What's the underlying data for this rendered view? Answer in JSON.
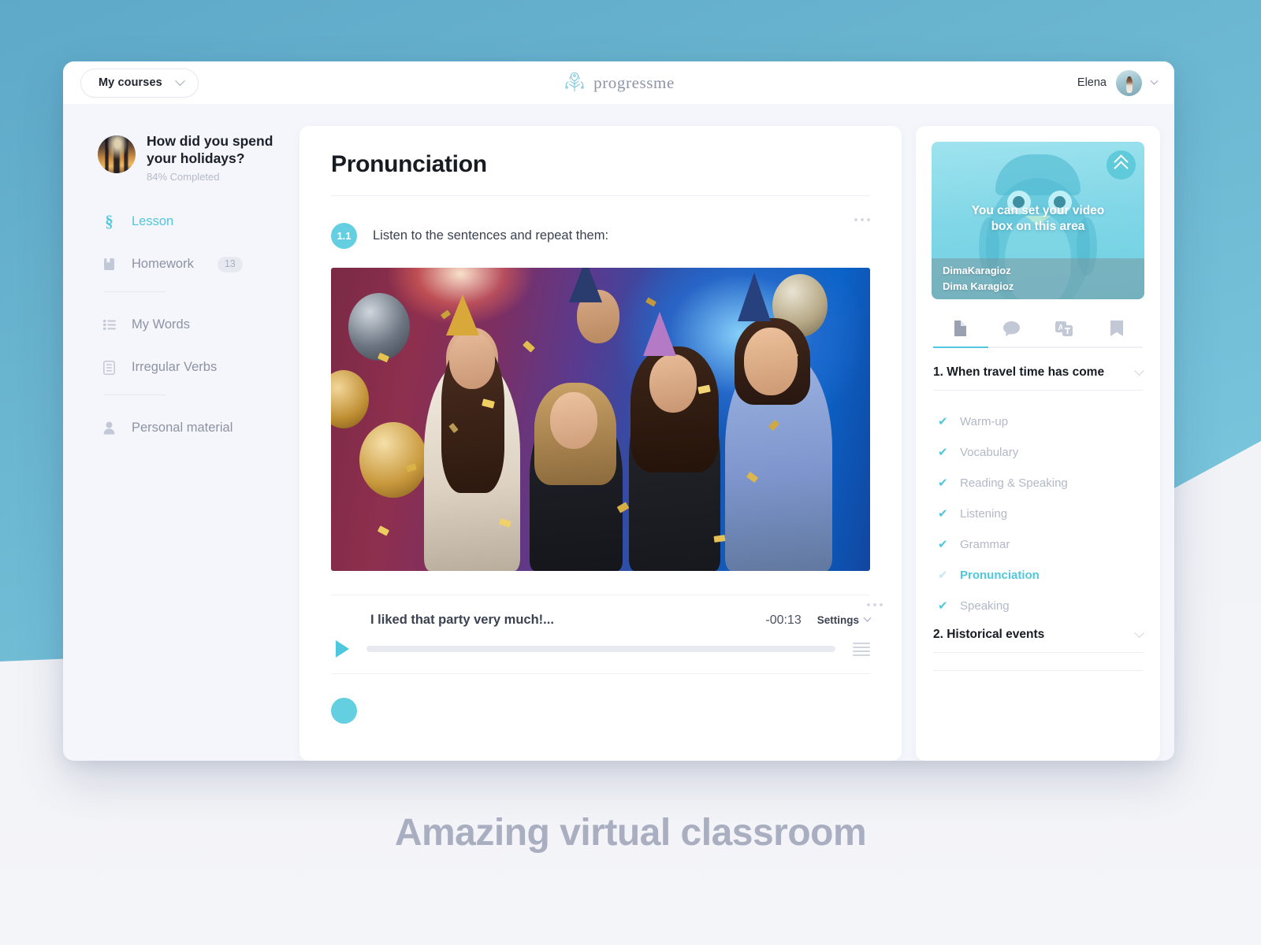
{
  "topbar": {
    "courses_label": "My courses",
    "courses_caret": "chevron-down-icon",
    "brand_name": "progressme",
    "brand_icon": "brain-tree-logo-icon",
    "user_name": "Elena",
    "user_caret": "chevron-down-icon"
  },
  "sidebar": {
    "course_title": "How did you spend your holidays?",
    "course_progress": "84% Completed",
    "items": [
      {
        "label": "Lesson",
        "icon": "section-sign-icon",
        "active": true,
        "badge": ""
      },
      {
        "label": "Homework",
        "icon": "bookmark-page-icon",
        "active": false,
        "badge": "13"
      },
      {
        "label": "My Words",
        "icon": "list-icon",
        "active": false,
        "badge": ""
      },
      {
        "label": "Irregular Verbs",
        "icon": "document-lines-icon",
        "active": false,
        "badge": ""
      },
      {
        "label": "Personal material",
        "icon": "person-icon",
        "active": false,
        "badge": ""
      }
    ]
  },
  "lesson": {
    "title": "Pronunciation",
    "task_number": "1.1",
    "task_text": "Listen to the sentences and repeat them:",
    "overflow_icon": "more-options-icon",
    "photo_alt": "party-photo-with-confetti"
  },
  "player": {
    "track_title": "I liked that party very much!...",
    "time_remaining": "-00:13",
    "settings_label": "Settings",
    "settings_caret": "chevron-down-icon",
    "play_icon": "play-icon",
    "volume_icon": "volume-lines-icon",
    "overflow_icon": "more-options-icon",
    "progress_percent": 0
  },
  "video_box": {
    "overlay_line1": "You can set your video",
    "overlay_line2": "box on this area",
    "name_primary": "DimaKaragioz",
    "name_secondary": "Dima Karagioz",
    "collapse_icon": "double-chevron-up-icon",
    "mascot": "penguin-mascot"
  },
  "tabs": [
    {
      "icon": "document-icon",
      "active": true
    },
    {
      "icon": "chat-bubble-icon",
      "active": false
    },
    {
      "icon": "translate-icon",
      "active": false
    },
    {
      "icon": "bookmark-icon",
      "active": false
    }
  ],
  "plan": {
    "unit1_title": "1. When travel time has come",
    "unit1_caret": "chevron-down-icon",
    "unit1_items": [
      {
        "label": "Warm-up",
        "checked": true,
        "active": false
      },
      {
        "label": "Vocabulary",
        "checked": true,
        "active": false
      },
      {
        "label": "Reading & Speaking",
        "checked": true,
        "active": false
      },
      {
        "label": "Listening",
        "checked": true,
        "active": false
      },
      {
        "label": "Grammar",
        "checked": true,
        "active": false
      },
      {
        "label": "Pronunciation",
        "checked": true,
        "active": true
      },
      {
        "label": "Speaking",
        "checked": true,
        "active": false
      }
    ],
    "unit2_title": "2. Historical events",
    "unit2_caret": "chevron-down-icon",
    "check_glyph": "✔"
  },
  "caption": "Amazing virtual classroom",
  "colors": {
    "accent": "#4fc7de",
    "accent_dark": "#5ecada",
    "background_blue": "#6cb7d1",
    "text_dark": "#171b22",
    "text_muted": "#b2b8c6"
  }
}
